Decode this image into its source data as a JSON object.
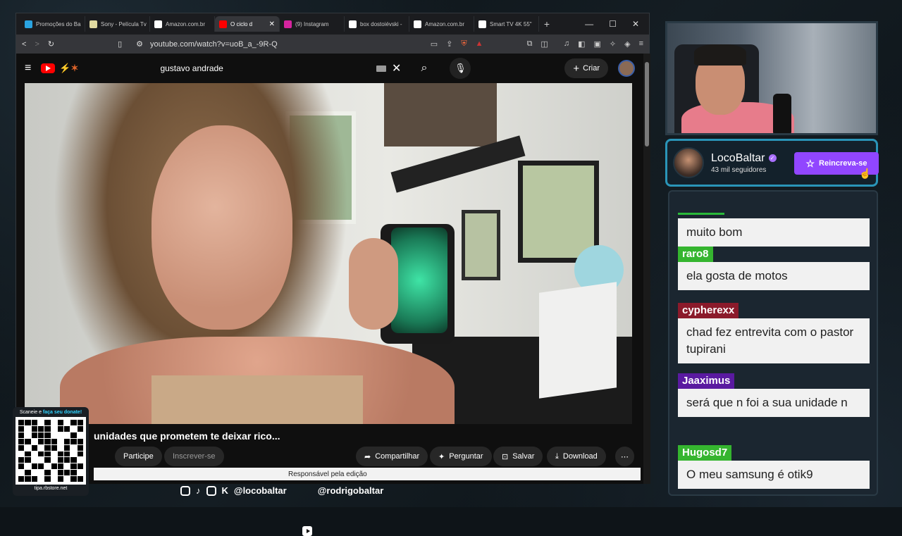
{
  "browser": {
    "tabs": [
      {
        "label": "Promoções do Ba",
        "fav": "telegram-icon",
        "color": "#2aa3e0"
      },
      {
        "label": "Sony - Película Tv",
        "fav": "globe-icon",
        "color": "#e0d9a0"
      },
      {
        "label": "Amazon.com.br",
        "fav": "amazon-icon",
        "color": "#ffffff"
      },
      {
        "label": "O ciclo d",
        "fav": "youtube-icon",
        "color": "#ff0000",
        "active": true
      },
      {
        "label": "(9) Instagram",
        "fav": "instagram-icon",
        "color": "#d6249f"
      },
      {
        "label": "box dostoiévski -",
        "fav": "google-icon",
        "color": "#ffffff"
      },
      {
        "label": "Amazon.com.br",
        "fav": "amazon-icon",
        "color": "#ffffff"
      },
      {
        "label": "Smart TV 4K 55\"",
        "fav": "amazon-icon",
        "color": "#ffffff"
      }
    ],
    "url": "youtube.com/watch?v=uoB_a_-9R-Q"
  },
  "youtube": {
    "search_value": "gustavo andrade",
    "create_label": "Criar",
    "video_title": "unidades que prometem te deixar rico...",
    "join_label": "Participe",
    "subscribe_label": "Inscrever-se",
    "share_label": "Compartilhar",
    "ask_label": "Perguntar",
    "save_label": "Salvar",
    "download_label": "Download",
    "edit_bar": "Responsável pela edição"
  },
  "profile": {
    "name": "LocoBaltar",
    "followers": "43 mil seguidores",
    "subscribe_label": "Reincreva-se"
  },
  "chat": [
    {
      "user": "",
      "color": "#2aba3a",
      "text": "muito bom"
    },
    {
      "user": "raro8",
      "color": "#35b52f",
      "text": "ela gosta de motos"
    },
    {
      "user": "cypherexx",
      "color": "#8b1a2b",
      "text": "chad fez entrevita com o pastor tupirani"
    },
    {
      "user": "Jaaximus",
      "color": "#5a1aa0",
      "text": "será que n foi a sua unidade n"
    },
    {
      "user": "Hugosd7",
      "color": "#35b52f",
      "text": "O meu samsung é otik9"
    }
  ],
  "qr": {
    "top_text": "Scaneie e",
    "top_highlight": "faça seu donate!",
    "url": "tipa.rbstore.net"
  },
  "socials": {
    "handle1": "@locobaltar",
    "handle2": "@rodrigobaltar"
  }
}
